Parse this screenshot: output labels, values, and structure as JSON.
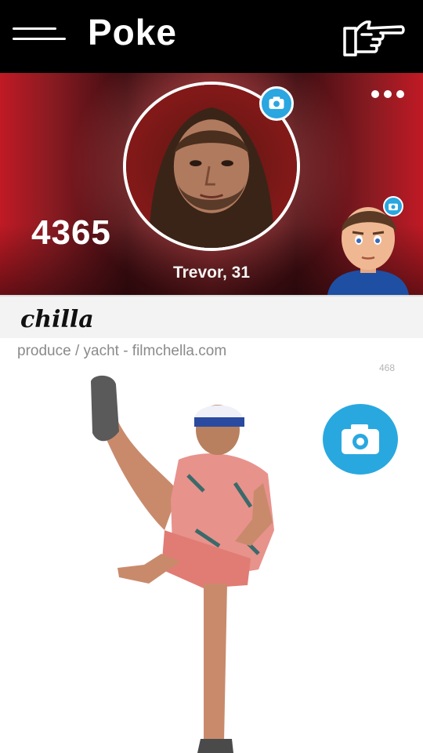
{
  "header": {
    "title": "Poke",
    "menu_icon": "hamburger-menu-icon",
    "poke_icon": "pointing-hand-icon"
  },
  "profile": {
    "name_age": "Trevor, 31",
    "points": "4365",
    "avatar": "profile-photo",
    "camera_icon": "camera-icon",
    "more_icon": "more-dots-icon",
    "friend_avatar": "bitmoji-avatar"
  },
  "status": {
    "text": "chilla"
  },
  "post": {
    "caption": "produce / yacht - filmchella.com",
    "count": "468",
    "camera_icon": "camera-icon"
  },
  "colors": {
    "header_bg": "#000000",
    "accent_blue": "#2aa6e0",
    "banner_red": "#c01a24",
    "strip_bg": "#f3f3f3"
  }
}
